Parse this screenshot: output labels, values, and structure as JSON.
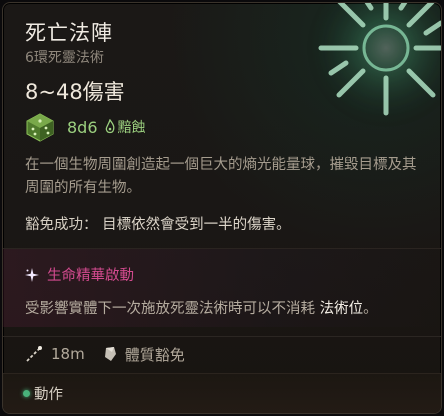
{
  "spell": {
    "name": "死亡法陣",
    "level_school": "6環死靈法術",
    "damage": "8~48傷害",
    "dice": "8d6",
    "damage_type": "黯蝕",
    "description": "在一個生物周圍創造起一個巨大的熵光能量球，摧毀目標及其周圍的所有生物。",
    "save_label": "豁免成功：",
    "save_text": "目標依然會受到一半的傷害。"
  },
  "empower": {
    "title": "生命精華啟動",
    "desc_prefix": "受影響實體下一次施放死靈法術時可以不消耗",
    "desc_highlight": "法術位",
    "desc_suffix": "。"
  },
  "meta": {
    "range": "18m",
    "save": "體質豁免"
  },
  "footer": {
    "action": "動作"
  },
  "colors": {
    "accent_green": "#9bd07f",
    "accent_pink": "#d24a8e",
    "action_dot": "#49b37b"
  },
  "icons": {
    "rune": "necrotic-rune-icon",
    "dice": "dice-icon",
    "damage_type": "necrotic-flame-icon",
    "empower": "sparkle-icon",
    "range": "range-icon",
    "save": "save-shield-icon"
  }
}
